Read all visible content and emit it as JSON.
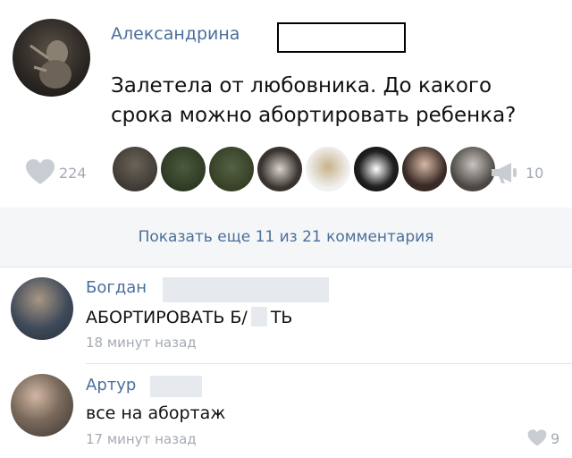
{
  "post": {
    "author": "Александрина",
    "text_lines": [
      "Залетела от любовника. До какого",
      "срока можно абортировать ребенка?"
    ],
    "likes_count": "224",
    "shares_count": "10",
    "like_icon": "heart-icon",
    "share_icon": "megaphone-icon"
  },
  "show_more": {
    "label": "Показать еще 11 из 21 комментария"
  },
  "comments": [
    {
      "author": "Богдан",
      "text_before": "АБОРТИРОВАТЬ Б/",
      "text_after": "ТЬ",
      "time": "18 минут назад"
    },
    {
      "author": "Артур",
      "text": "все на абортаж",
      "time": "17 минут назад",
      "likes_count": "9"
    }
  ],
  "colors": {
    "link": "#4a6f9b",
    "muted": "#a4aab3",
    "divider": "#e2e5ea",
    "show_more_bg": "#f5f6f8"
  }
}
